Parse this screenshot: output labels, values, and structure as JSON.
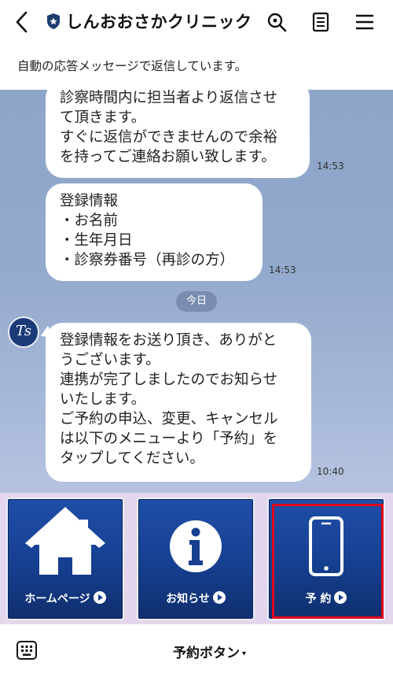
{
  "header": {
    "title": "しんおおさかクリニック",
    "icons": [
      "back-arrow",
      "verified-shield",
      "search",
      "notes",
      "menu"
    ]
  },
  "notice": "自動の応答メッセージで返信しています。",
  "chat": {
    "date_divider": "今日",
    "avatar_initials": "Ts",
    "messages": [
      {
        "lines": [
          "診察時間内に担当者より返信させ",
          "て頂きます。",
          "すぐに返信ができませんので余裕",
          "を持ってご連絡お願い致します。"
        ],
        "time": "14:53"
      },
      {
        "lines": [
          "登録情報",
          "・お名前",
          "・生年月日",
          "・診察券番号（再診の方）"
        ],
        "time": "14:53"
      },
      {
        "lines": [
          "登録情報をお送り頂き、ありがと",
          "うございます。",
          "連携が完了しましたのでお知らせ",
          "いたします。",
          "ご予約の申込、変更、キャンセル",
          "は以下のメニューより「予約」を",
          "タップしてください。"
        ],
        "time": "10:40"
      }
    ]
  },
  "rich_menu": {
    "items": [
      {
        "label": "ホームページ",
        "icon": "house-icon"
      },
      {
        "label": "お知らせ",
        "icon": "info-icon"
      },
      {
        "label": "予 約",
        "icon": "smartphone-icon"
      }
    ],
    "highlight_color": "#e0001a"
  },
  "bottom_bar": {
    "menu_label": "予約ボタン",
    "caret": "▾"
  },
  "colors": {
    "tile_blue": "#163f90",
    "chat_bg": "#93a9cd",
    "rich_menu_bg": "#e4d6ec"
  }
}
